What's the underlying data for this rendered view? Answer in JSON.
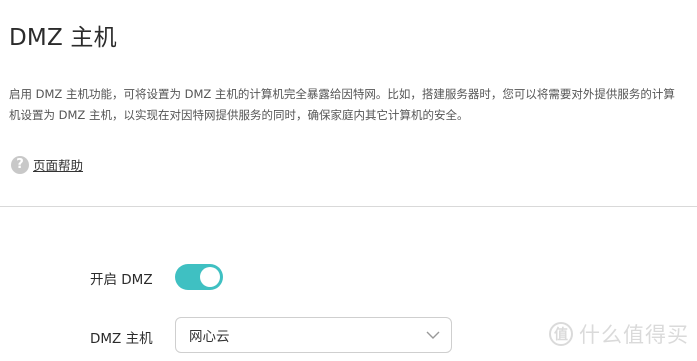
{
  "header": {
    "title": "DMZ 主机"
  },
  "description": {
    "text": "启用 DMZ 主机功能，可将设置为 DMZ 主机的计算机完全暴露给因特网。比如，搭建服务器时，您可以将需要对外提供服务的计算机设置为 DMZ 主机，以实现在对因特网提供服务的同时，确保家庭内其它计算机的安全。"
  },
  "help": {
    "icon": "help-circle-icon",
    "icon_glyph": "?",
    "label": "页面帮助"
  },
  "settings": {
    "enable_label": "开启 DMZ",
    "enable_state": true,
    "toggle_color": "#3fc0c2",
    "host_label": "DMZ 主机",
    "host_value": "网心云"
  },
  "watermark": {
    "badge_glyph": "值",
    "text": "什么值得买"
  }
}
